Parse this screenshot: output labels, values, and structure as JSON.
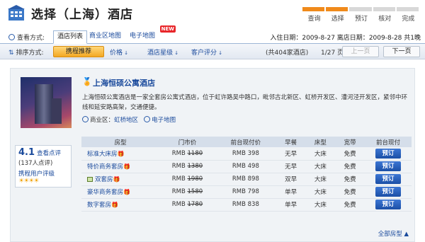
{
  "header": {
    "title": "选择（上海）酒店",
    "steps": [
      "查询",
      "选择",
      "预订",
      "核对",
      "完成"
    ],
    "active_steps": 2
  },
  "viewbar": {
    "label": "查看方式:",
    "tabs": [
      "酒店列表",
      "商业区地图",
      "电子地图"
    ],
    "new_badge": "NEW",
    "checkin_label": "入住日期：",
    "checkin": "2009-8-27",
    "checkout_label": "离店日期：",
    "checkout": "2009-8-28",
    "nights": "共1晚"
  },
  "sortbar": {
    "label": "排序方式:",
    "selected": "携程推荐",
    "options": [
      "价格",
      "酒店星级",
      "客户评分"
    ],
    "total": "(共404家酒店)",
    "page": "1/27 页",
    "prev": "上一页",
    "next": "下一页"
  },
  "hotel": {
    "name": "上海恒硕公寓酒店",
    "description": "上海恒硕公寓酒店是一家全套房公寓式酒店，位于虹许路吴中路口，毗邻古北新区、虹桥开发区、漕河泾开发区，紧邻中环线和延安路高架，交通便捷。",
    "district_label": "商业区：",
    "district": "虹桥地区",
    "map_link": "电子地图",
    "rating": {
      "score": "4.1",
      "reviews_link": "查看点评",
      "count": "(137人点评)",
      "level": "携程用户评级",
      "stars": "☀☀☀☀"
    },
    "table_headers": [
      "房型",
      "门市价",
      "前台现付价",
      "早餐",
      "床型",
      "宽带",
      "前台现付"
    ],
    "rooms": [
      {
        "name": "标准大床房",
        "list": "1180",
        "price": "RMB 398",
        "breakfast": "无早",
        "bed": "大床",
        "net": "免费",
        "book": "预订",
        "img": false
      },
      {
        "name": "特价商务套房",
        "list": "1380",
        "price": "RMB 498",
        "breakfast": "无早",
        "bed": "大床",
        "net": "免费",
        "book": "预订",
        "img": false
      },
      {
        "name": "双套房",
        "list": "1980",
        "price": "RMB 898",
        "breakfast": "双早",
        "bed": "大床",
        "net": "免费",
        "book": "预订",
        "img": true
      },
      {
        "name": "豪华商务套房",
        "list": "1580",
        "price": "RMB 798",
        "breakfast": "单早",
        "bed": "大床",
        "net": "免费",
        "book": "预订",
        "img": false
      },
      {
        "name": "数字套房",
        "list": "1780",
        "price": "RMB 838",
        "breakfast": "单早",
        "bed": "大床",
        "net": "免费",
        "book": "预订",
        "img": false
      }
    ],
    "rmb_prefix": "RMB",
    "gift_icon": "🎁",
    "all_rooms": "全部房型 ▲"
  },
  "colors": {
    "accent": "#f08a1b",
    "link": "#1a4a9c",
    "book_button": "#1b4fa6"
  }
}
